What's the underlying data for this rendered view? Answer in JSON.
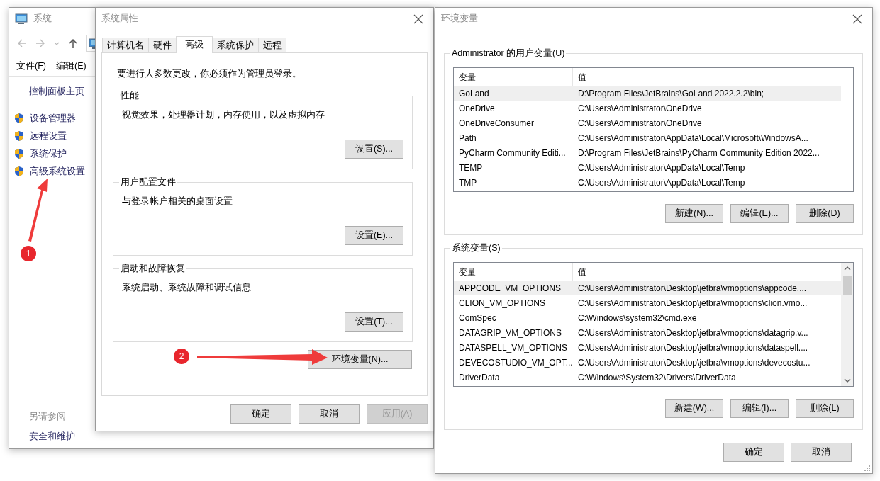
{
  "system_window": {
    "title": "系统",
    "menu": [
      "文件(F)",
      "编辑(E)"
    ],
    "sidebar": {
      "home": "控制面板主页",
      "items": [
        "设备管理器",
        "远程设置",
        "系统保护",
        "高级系统设置"
      ]
    },
    "see_also": {
      "heading": "另请参阅",
      "links": [
        "安全和维护"
      ]
    }
  },
  "system_properties": {
    "title": "系统属性",
    "tabs": [
      {
        "label": "计算机名",
        "selected": false
      },
      {
        "label": "硬件",
        "selected": false
      },
      {
        "label": "高级",
        "selected": true
      },
      {
        "label": "系统保护",
        "selected": false
      },
      {
        "label": "远程",
        "selected": false
      }
    ],
    "notice": "要进行大多数更改，你必须作为管理员登录。",
    "groups": [
      {
        "title": "性能",
        "description": "视觉效果，处理器计划，内存使用，以及虚拟内存",
        "button": "设置(S)..."
      },
      {
        "title": "用户配置文件",
        "description": "与登录帐户相关的桌面设置",
        "button": "设置(E)..."
      },
      {
        "title": "启动和故障恢复",
        "description": "系统启动、系统故障和调试信息",
        "button": "设置(T)..."
      }
    ],
    "env_button": "环境变量(N)...",
    "buttons": [
      {
        "label": "确定",
        "disabled": false
      },
      {
        "label": "取消",
        "disabled": false
      },
      {
        "label": "应用(A)",
        "disabled": true
      }
    ]
  },
  "environment_variables": {
    "title": "环境变量",
    "sections": [
      {
        "title": "Administrator 的用户变量(U)",
        "columns": [
          "变量",
          "值"
        ],
        "scrollbar": false,
        "rows": [
          {
            "name": "GoLand",
            "value": "D:\\Program Files\\JetBrains\\GoLand 2022.2.2\\bin;",
            "selected": true
          },
          {
            "name": "OneDrive",
            "value": "C:\\Users\\Administrator\\OneDrive",
            "selected": false
          },
          {
            "name": "OneDriveConsumer",
            "value": "C:\\Users\\Administrator\\OneDrive",
            "selected": false
          },
          {
            "name": "Path",
            "value": "C:\\Users\\Administrator\\AppData\\Local\\Microsoft\\WindowsA...",
            "selected": false
          },
          {
            "name": "PyCharm Community Editi...",
            "value": "D:\\Program Files\\JetBrains\\PyCharm Community Edition 2022...",
            "selected": false
          },
          {
            "name": "TEMP",
            "value": "C:\\Users\\Administrator\\AppData\\Local\\Temp",
            "selected": false
          },
          {
            "name": "TMP",
            "value": "C:\\Users\\Administrator\\AppData\\Local\\Temp",
            "selected": false
          }
        ],
        "buttons": [
          "新建(N)...",
          "编辑(E)...",
          "删除(D)"
        ]
      },
      {
        "title": "系统变量(S)",
        "columns": [
          "变量",
          "值"
        ],
        "scrollbar": true,
        "rows": [
          {
            "name": "APPCODE_VM_OPTIONS",
            "value": "C:\\Users\\Administrator\\Desktop\\jetbra\\vmoptions\\appcode....",
            "selected": true
          },
          {
            "name": "CLION_VM_OPTIONS",
            "value": "C:\\Users\\Administrator\\Desktop\\jetbra\\vmoptions\\clion.vmo...",
            "selected": false
          },
          {
            "name": "ComSpec",
            "value": "C:\\Windows\\system32\\cmd.exe",
            "selected": false
          },
          {
            "name": "DATAGRIP_VM_OPTIONS",
            "value": "C:\\Users\\Administrator\\Desktop\\jetbra\\vmoptions\\datagrip.v...",
            "selected": false
          },
          {
            "name": "DATASPELL_VM_OPTIONS",
            "value": "C:\\Users\\Administrator\\Desktop\\jetbra\\vmoptions\\dataspell....",
            "selected": false
          },
          {
            "name": "DEVECOSTUDIO_VM_OPT...",
            "value": "C:\\Users\\Administrator\\Desktop\\jetbra\\vmoptions\\devecostu...",
            "selected": false
          },
          {
            "name": "DriverData",
            "value": "C:\\Windows\\System32\\Drivers\\DriverData",
            "selected": false
          }
        ],
        "buttons": [
          "新建(W)...",
          "编辑(I)...",
          "删除(L)"
        ]
      }
    ],
    "buttons": [
      "确定",
      "取消"
    ]
  },
  "annotations": [
    {
      "label": "1"
    },
    {
      "label": "2"
    }
  ]
}
